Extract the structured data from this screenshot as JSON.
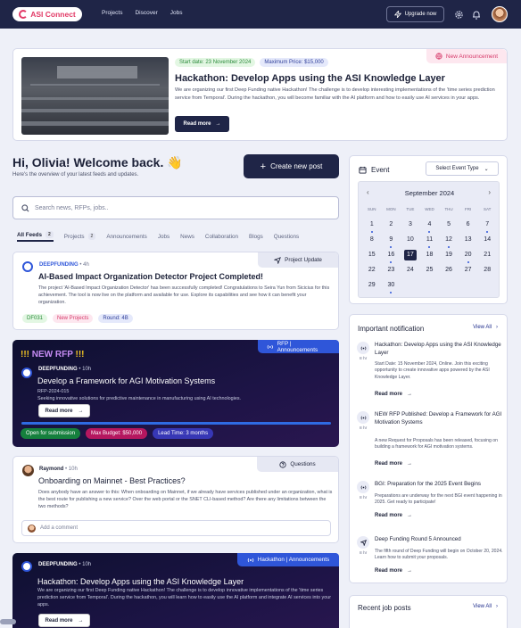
{
  "nav": {
    "logo": "ASI Connect",
    "links": [
      "Projects",
      "Discover",
      "Jobs"
    ],
    "upgrade": "Upgrade now"
  },
  "hero": {
    "tag": "New Announcement",
    "start_date": "Start date: 23 November 2024",
    "max_price": "Maximum Price: $15,000",
    "title": "Hackathon: Develop Apps using the ASI Knowledge Layer",
    "desc": "We are organizing our first Deep Funding native Hackathon! The challenge is to develop interesting implementations of the 'time series prediction service from Temporal'. During the hackathon, you will become familiar with the AI platform and how to easily use AI services in your apps.",
    "read_more": "Read more"
  },
  "greeting": {
    "title": "Hi, Olivia! Welcome back. 👋",
    "subtitle": "Here's the overview of your latest feeds and updates."
  },
  "create_post": "Create new post",
  "search": {
    "placeholder": "Search news, RFPs, jobs.."
  },
  "tabs": [
    {
      "label": "All Feeds",
      "count": "2"
    },
    {
      "label": "Projects",
      "count": "2"
    },
    {
      "label": "Announcements"
    },
    {
      "label": "Jobs"
    },
    {
      "label": "News"
    },
    {
      "label": "Collaboration"
    },
    {
      "label": "Blogs"
    },
    {
      "label": "Questions"
    }
  ],
  "posts": {
    "p1": {
      "tag": "Project Update",
      "author": "DEEPFUNDING",
      "time": "• 4h",
      "title": "AI-Based Impact Organization Detector Project Completed!",
      "desc": "The project 'AI-Based Impact Organization Detector' has been successfully completed! Congratulations to Seira Yun from Sicicius for this achievement. The tool is now live on the platform and available for use. Explore its capabilities and see how it can benefit your organization.",
      "chips": [
        "DF031",
        "New Projects",
        "Round: 4B"
      ]
    },
    "p2": {
      "tag": "RFP | Announcements",
      "banner_prefix": "!!! ",
      "banner": "NEW RFP",
      "banner_suffix": " !!!",
      "author": "DEEPFUNDING",
      "time": "• 10h",
      "title": "Develop a Framework for AGI Motivation Systems",
      "ref": "RFP-2024-015",
      "desc": "Seeking innovative solutions for predictive maintenance in manufacturing using AI technologies.",
      "read_more": "Read more",
      "chips": [
        "Open for submission",
        "Max Budget: $50,000",
        "Lead Time: 3 months"
      ]
    },
    "p3": {
      "tag": "Questions",
      "author": "Raymond",
      "time": "• 10h",
      "title": "Onboarding on Mainnet - Best Practices?",
      "desc": "Does anybody have an answer to this: When onboarding on Mainnet, if we already have services published under an organization, what is the best route for publishing a new service? Over the web portal or the SNET CLI-based method? Are there any limitations between the two methods?",
      "comment_placeholder": "Add a comment"
    },
    "p4": {
      "tag": "Hackathon | Announcements",
      "author": "DEEPFUNDING",
      "time": "• 10h",
      "title": "Hackathon: Develop Apps using the ASI Knowledge Layer",
      "desc": "We are organizing our first Deep Funding native Hackathon! The challenge is to develop innovative implementations of the 'time series prediction service from Temporal'. During the hackathon, you will learn how to easily use the AI platform and integrate AI services into your apps.",
      "read_more": "Read more"
    }
  },
  "event": {
    "title": "Event",
    "select": "Select Event Type",
    "month": "September 2024",
    "weekdays": [
      "SUN",
      "MON",
      "TUE",
      "WED",
      "THU",
      "FRI",
      "SAT"
    ],
    "days": [
      "1",
      "2",
      "3",
      "4",
      "5",
      "6",
      "7",
      "8",
      "9",
      "10",
      "11",
      "12",
      "13",
      "14",
      "15",
      "16",
      "17",
      "18",
      "19",
      "20",
      "21",
      "22",
      "23",
      "24",
      "25",
      "26",
      "27",
      "28",
      "29",
      "30"
    ],
    "dot_days": [
      "1",
      "4",
      "7",
      "9",
      "11",
      "12",
      "16",
      "20",
      "30"
    ],
    "today": "17"
  },
  "notifications": {
    "title": "Important notification",
    "view_all": "View All",
    "items": [
      {
        "title": "Hackathon: Develop Apps using the ASI Knowledge Layer",
        "time": "8 hr",
        "desc": "Start Date: 15 November 2024, Online. Join this exciting opportunity to create innovative apps powered by the ASI Knowledge Layer.",
        "link": "Read more",
        "icon": "broadcast-icon"
      },
      {
        "title": "NEW RFP Published: Develop a Framework for AGI Motivation Systems",
        "time": "8 hr",
        "desc": "A new Request for Proposals has been released, focusing on building a framework for AGI motivation systems.",
        "link": "Read more",
        "icon": "broadcast-icon"
      },
      {
        "title": "BGI: Preparation for the 2025 Event Begins",
        "time": "8 hr",
        "desc": "Preparations are underway for the next BGI event happening in 2025. Get ready to participate!",
        "link": "Read more",
        "icon": "broadcast-icon"
      },
      {
        "title": "Deep Funding Round 5 Announced",
        "time": "8 hr",
        "desc": "The fifth round of Deep Funding will begin on October 20, 2024. Learn how to submit your proposals.",
        "link": "Read more",
        "icon": "send-icon"
      }
    ]
  },
  "jobs": {
    "title": "Recent job posts",
    "view_all": "View All"
  },
  "colors": {
    "navy": "#1f2547",
    "accent_pink": "#e23a66",
    "blue": "#2f56d9"
  }
}
